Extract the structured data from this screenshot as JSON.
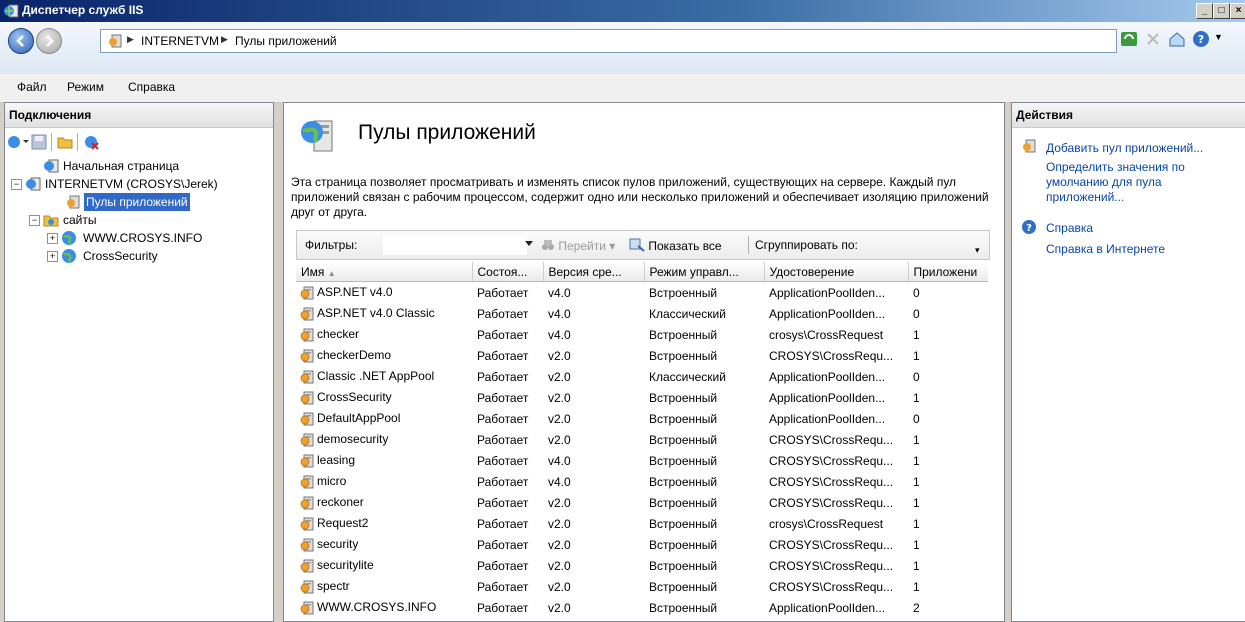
{
  "window": {
    "title": "Диспетчер служб IIS"
  },
  "breadcrumb": {
    "items": [
      "INTERNETVM",
      "Пулы приложений"
    ]
  },
  "menu": {
    "items": [
      "Файл",
      "Режим",
      "Справка"
    ]
  },
  "connections": {
    "header": "Подключения",
    "tree": {
      "start_page": "Начальная страница",
      "server": "INTERNETVM (CROSYS\\Jerek)",
      "app_pools": "Пулы приложений",
      "sites": "сайты",
      "site1": "WWW.CROSYS.INFO",
      "site2": "CrossSecurity"
    }
  },
  "main": {
    "title": "Пулы приложений",
    "description": "Эта страница позволяет просматривать и изменять список пулов приложений, существующих на сервере. Каждый пул приложений связан с рабочим процессом, содержит одно или несколько приложений и обеспечивает изоляцию приложений друг от друга.",
    "filter_label": "Фильтры:",
    "filter_placeholder": "",
    "go_label": "Перейти",
    "show_all_label": "Показать все",
    "group_by_label": "Сгруппировать по:",
    "columns": [
      "Имя",
      "Состоя...",
      "Версия сре...",
      "Режим управл...",
      "Удостоверение",
      "Приложени"
    ],
    "sort_indicator": "▲",
    "rows": [
      [
        "ASP.NET v4.0",
        "Работает",
        "v4.0",
        "Встроенный",
        "ApplicationPoolIden...",
        "0"
      ],
      [
        "ASP.NET v4.0 Classic",
        "Работает",
        "v4.0",
        "Классический",
        "ApplicationPoolIden...",
        "0"
      ],
      [
        "checker",
        "Работает",
        "v4.0",
        "Встроенный",
        "crosys\\CrossRequest",
        "1"
      ],
      [
        "checkerDemo",
        "Работает",
        "v2.0",
        "Встроенный",
        "CROSYS\\CrossRequ...",
        "1"
      ],
      [
        "Classic .NET AppPool",
        "Работает",
        "v2.0",
        "Классический",
        "ApplicationPoolIden...",
        "0"
      ],
      [
        "CrossSecurity",
        "Работает",
        "v2.0",
        "Встроенный",
        "ApplicationPoolIden...",
        "1"
      ],
      [
        "DefaultAppPool",
        "Работает",
        "v2.0",
        "Встроенный",
        "ApplicationPoolIden...",
        "0"
      ],
      [
        "demosecurity",
        "Работает",
        "v2.0",
        "Встроенный",
        "CROSYS\\CrossRequ...",
        "1"
      ],
      [
        "leasing",
        "Работает",
        "v4.0",
        "Встроенный",
        "CROSYS\\CrossRequ...",
        "1"
      ],
      [
        "micro",
        "Работает",
        "v4.0",
        "Встроенный",
        "CROSYS\\CrossRequ...",
        "1"
      ],
      [
        "reckoner",
        "Работает",
        "v2.0",
        "Встроенный",
        "CROSYS\\CrossRequ...",
        "1"
      ],
      [
        "Request2",
        "Работает",
        "v2.0",
        "Встроенный",
        "crosys\\CrossRequest",
        "1"
      ],
      [
        "security",
        "Работает",
        "v2.0",
        "Встроенный",
        "CROSYS\\CrossRequ...",
        "1"
      ],
      [
        "securitylite",
        "Работает",
        "v2.0",
        "Встроенный",
        "CROSYS\\CrossRequ...",
        "1"
      ],
      [
        "spectr",
        "Работает",
        "v2.0",
        "Встроенный",
        "CROSYS\\CrossRequ...",
        "1"
      ],
      [
        "WWW.CROSYS.INFO",
        "Работает",
        "v2.0",
        "Встроенный",
        "ApplicationPoolIden...",
        "2"
      ]
    ]
  },
  "actions": {
    "header": "Действия",
    "add_pool": "Добавить пул приложений...",
    "set_defaults": "Определить значения по умолчанию для пула приложений...",
    "help": "Справка",
    "online_help": "Справка в Интернете"
  },
  "colors": {
    "selection": "#3169c6",
    "link": "#0645ad",
    "title_bar": "#0a246a"
  }
}
